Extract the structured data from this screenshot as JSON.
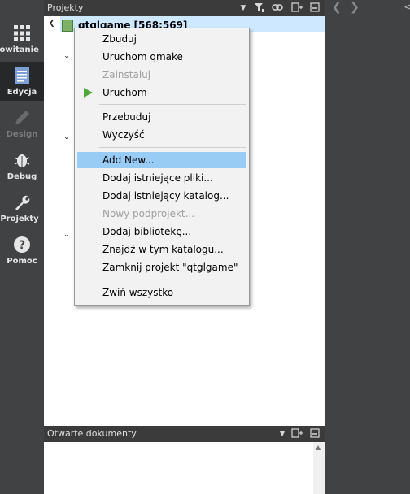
{
  "modes": [
    {
      "label": "Powitanie",
      "icon": "grid-icon"
    },
    {
      "label": "Edycja",
      "icon": "document-icon",
      "active": true
    },
    {
      "label": "Design",
      "icon": "pencil-icon",
      "disabled": true
    },
    {
      "label": "Debug",
      "icon": "bug-icon"
    },
    {
      "label": "Projekty",
      "icon": "wrench-icon"
    },
    {
      "label": "Pomoc",
      "icon": "help-icon"
    }
  ],
  "projects_panel": {
    "title": "Projekty",
    "project_name": "qtglgame [568:569]"
  },
  "open_documents": {
    "title": "Otwarte dokumenty"
  },
  "context_menu": {
    "items": [
      {
        "label": "Zbuduj"
      },
      {
        "label": "Uruchom qmake"
      },
      {
        "label": "Zainstaluj",
        "disabled": true
      },
      {
        "label": "Uruchom",
        "icon": "run-icon"
      },
      {
        "label": "Przebuduj"
      },
      {
        "label": "Wyczyść"
      },
      {
        "label": "Add New...",
        "highlighted": true
      },
      {
        "label": "Dodaj istniejące pliki..."
      },
      {
        "label": "Dodaj istniejący katalog..."
      },
      {
        "label": "Nowy podprojekt...",
        "disabled": true
      },
      {
        "label": "Dodaj bibliotekę..."
      },
      {
        "label": "Znajdź w tym katalogu..."
      },
      {
        "label": "Zamknij projekt \"qtglgame\""
      },
      {
        "label": "Zwiń wszystko"
      }
    ]
  },
  "colors": {
    "highlight": "#99ccf5",
    "selection_row": "#cde8ff",
    "run_green": "#4fa73a",
    "sidebar": "#404244"
  }
}
